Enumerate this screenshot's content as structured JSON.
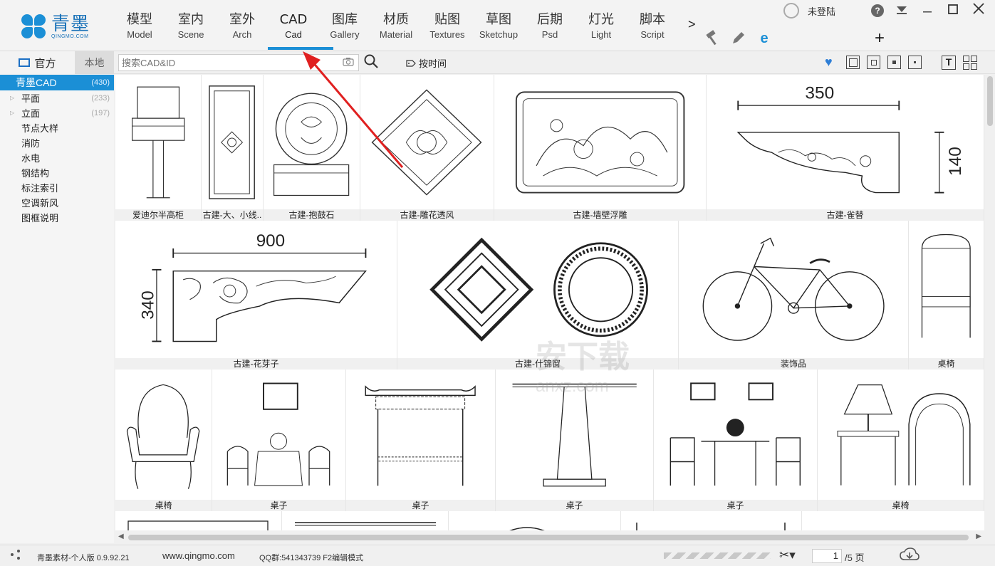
{
  "app": {
    "logo_cn": "青墨",
    "logo_en": "QINGMO.COM"
  },
  "nav": {
    "tabs": [
      {
        "cn": "模型",
        "en": "Model"
      },
      {
        "cn": "室内",
        "en": "Scene"
      },
      {
        "cn": "室外",
        "en": "Arch"
      },
      {
        "cn": "CAD",
        "en": "Cad"
      },
      {
        "cn": "图库",
        "en": "Gallery"
      },
      {
        "cn": "材质",
        "en": "Material"
      },
      {
        "cn": "贴图",
        "en": "Textures"
      },
      {
        "cn": "草图",
        "en": "Sketchup"
      },
      {
        "cn": "后期",
        "en": "Psd"
      },
      {
        "cn": "灯光",
        "en": "Light"
      },
      {
        "cn": "脚本",
        "en": "Script"
      }
    ],
    "active_index": 3,
    "more": ">",
    "plus": "+"
  },
  "user": {
    "name": "未登陆",
    "help": "?"
  },
  "source": {
    "official": "官方",
    "local": "本地"
  },
  "search": {
    "placeholder": "搜索CAD&ID",
    "sort_label": "按时间"
  },
  "sidebar": {
    "root": {
      "label": "青墨CAD",
      "count": "(430)"
    },
    "items": [
      {
        "label": "平面",
        "count": "(233)",
        "expandable": true
      },
      {
        "label": "立面",
        "count": "(197)",
        "expandable": true
      },
      {
        "label": "节点大样",
        "count": "",
        "expandable": false
      },
      {
        "label": "消防",
        "count": "",
        "expandable": false
      },
      {
        "label": "水电",
        "count": "",
        "expandable": false
      },
      {
        "label": "钢结构",
        "count": "",
        "expandable": false
      },
      {
        "label": "标注索引",
        "count": "",
        "expandable": false
      },
      {
        "label": "空调新风",
        "count": "",
        "expandable": false
      },
      {
        "label": "图框说明",
        "count": "",
        "expandable": false
      }
    ]
  },
  "grid": {
    "row1": [
      "爱迪尔半高柜",
      "古建-大、小线..",
      "古建-抱鼓石",
      "古建-雕花透风",
      "古建-墙壁浮雕",
      "古建-雀替"
    ],
    "row2": [
      "古建-花芽子",
      "古建-什锦窗",
      "装饰品",
      "桌椅"
    ],
    "row3": [
      "桌椅",
      "桌子",
      "桌子",
      "桌子",
      "桌子",
      "桌椅"
    ],
    "dim_350": "350",
    "dim_140": "140",
    "dim_900": "900",
    "dim_340": "340"
  },
  "status": {
    "version": "青墨素材-个人版 0.9.92.21",
    "site": "www.qingmo.com",
    "qq": "QQ群:541343739 F2编辑模式",
    "page": "1",
    "page_total": "/5 页"
  },
  "watermark": {
    "text": "安下载",
    "sub": "anxz.com"
  },
  "colors": {
    "accent": "#1b8fd6",
    "annotation": "#e02020"
  }
}
